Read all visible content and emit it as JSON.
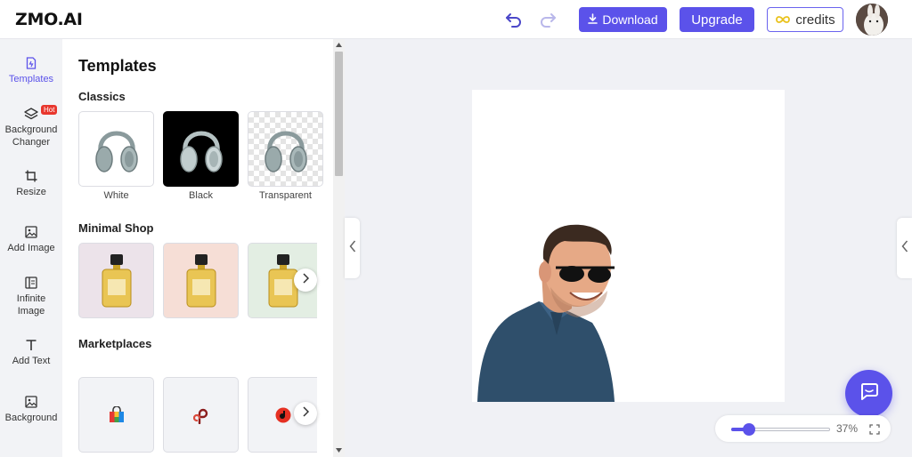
{
  "app": {
    "logo": "ZMO.AI"
  },
  "header": {
    "download_label": "Download",
    "upgrade_label": "Upgrade",
    "credits_label": "credits",
    "icons": [
      "undo-icon",
      "redo-icon",
      "download-icon",
      "infinity-icon",
      "avatar"
    ]
  },
  "rail": {
    "items": [
      {
        "label": "Templates",
        "icon": "templates-icon",
        "active": true
      },
      {
        "label": "Background Changer",
        "icon": "layers-icon",
        "badge": "Hot"
      },
      {
        "label": "Resize",
        "icon": "crop-icon"
      },
      {
        "label": "Add Image",
        "icon": "image-icon"
      },
      {
        "label": "Infinite Image",
        "icon": "expand-image-icon"
      },
      {
        "label": "Add Text",
        "icon": "text-icon"
      },
      {
        "label": "Background",
        "icon": "background-icon"
      }
    ]
  },
  "panel": {
    "title": "Templates",
    "classics": {
      "title": "Classics",
      "items": [
        {
          "label": "White"
        },
        {
          "label": "Black"
        },
        {
          "label": "Transparent"
        }
      ]
    },
    "minimal_shop": {
      "title": "Minimal Shop"
    },
    "marketplaces": {
      "title": "Marketplaces"
    }
  },
  "canvas": {
    "zoom": "37%"
  },
  "colors": {
    "accent": "#5b52ea",
    "hot_badge": "#e8362d",
    "canvas_bg": "#f0f1f5"
  }
}
